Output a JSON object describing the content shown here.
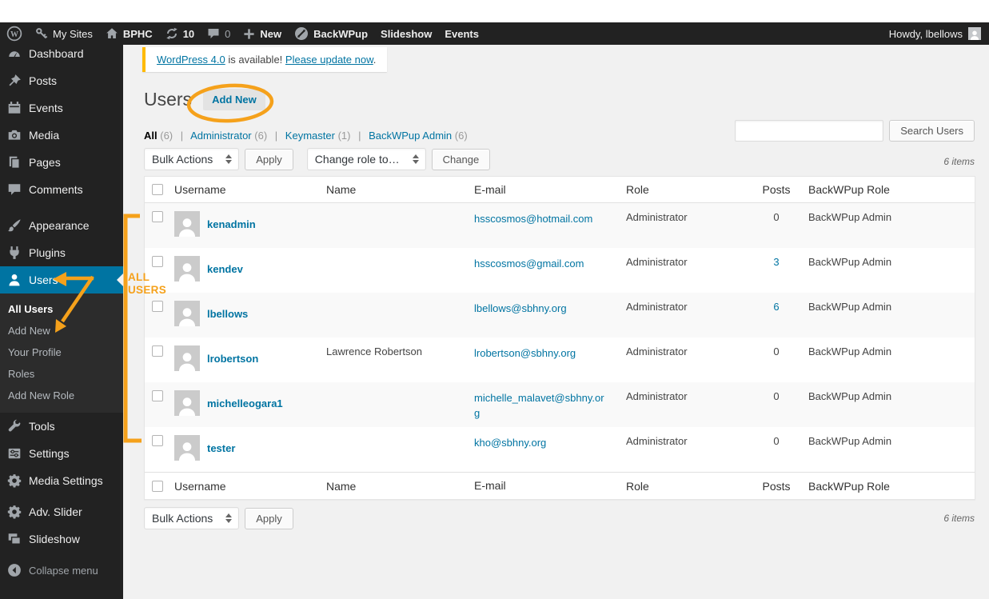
{
  "admin_bar": {
    "my_sites": "My Sites",
    "site_name": "BPHC",
    "update_count": "10",
    "comment_count": "0",
    "new_label": "New",
    "backwpup": "BackWPup",
    "slideshow": "Slideshow",
    "events": "Events",
    "howdy": "Howdy, lbellows"
  },
  "sidebar": {
    "items": [
      {
        "label": "Dashboard"
      },
      {
        "label": "Posts"
      },
      {
        "label": "Events"
      },
      {
        "label": "Media"
      },
      {
        "label": "Pages"
      },
      {
        "label": "Comments"
      },
      {
        "label": "Appearance"
      },
      {
        "label": "Plugins"
      },
      {
        "label": "Users"
      },
      {
        "label": "Tools"
      },
      {
        "label": "Settings"
      },
      {
        "label": "Media Settings"
      },
      {
        "label": "Adv. Slider"
      },
      {
        "label": "Slideshow"
      }
    ],
    "users_submenu": [
      {
        "label": "All Users"
      },
      {
        "label": "Add New"
      },
      {
        "label": "Your Profile"
      },
      {
        "label": "Roles"
      },
      {
        "label": "Add New Role"
      }
    ],
    "collapse": "Collapse menu"
  },
  "notice": {
    "link_version": "WordPress 4.0",
    "text_middle": " is available! ",
    "link_update": "Please update now",
    "text_end": "."
  },
  "page": {
    "title": "Users",
    "add_new": "Add New"
  },
  "filters": {
    "all_label": "All",
    "all_count": "(6)",
    "admin_label": "Administrator",
    "admin_count": "(6)",
    "keymaster_label": "Keymaster",
    "keymaster_count": "(1)",
    "backwpup_label": "BackWPup Admin",
    "backwpup_count": "(6)"
  },
  "toolbar": {
    "bulk_actions": "Bulk Actions",
    "apply": "Apply",
    "change_role": "Change role to…",
    "change": "Change",
    "search_button": "Search Users",
    "items_count": "6 items"
  },
  "table": {
    "columns": {
      "username": "Username",
      "name": "Name",
      "email": "E-mail",
      "role": "Role",
      "posts": "Posts",
      "backwpup_role": "BackWPup Role"
    },
    "rows": [
      {
        "username": "kenadmin",
        "name": "",
        "email": "hsscosmos@hotmail.com",
        "role": "Administrator",
        "posts": "0",
        "backwpup_role": "BackWPup Admin"
      },
      {
        "username": "kendev",
        "name": "",
        "email": "hsscosmos@gmail.com",
        "role": "Administrator",
        "posts": "3",
        "backwpup_role": "BackWPup Admin"
      },
      {
        "username": "lbellows",
        "name": "",
        "email": "lbellows@sbhny.org",
        "role": "Administrator",
        "posts": "6",
        "backwpup_role": "BackWPup Admin"
      },
      {
        "username": "lrobertson",
        "name": "Lawrence Robertson",
        "email": "lrobertson@sbhny.org",
        "role": "Administrator",
        "posts": "0",
        "backwpup_role": "BackWPup Admin"
      },
      {
        "username": "michelleogara1",
        "name": "",
        "email": "michelle_malavet@sbhny.org",
        "role": "Administrator",
        "posts": "0",
        "backwpup_role": "BackWPup Admin"
      },
      {
        "username": "tester",
        "name": "",
        "email": "kho@sbhny.org",
        "role": "Administrator",
        "posts": "0",
        "backwpup_role": "BackWPup Admin"
      }
    ]
  },
  "annotations": {
    "label_line1": "ALL",
    "label_line2": "USERS"
  },
  "colors": {
    "accent_blue": "#0074A2",
    "annotation_orange": "#F5A11B",
    "notice_border": "#FFBA00",
    "sidebar_bg": "#222222",
    "stripe": "#F9F9F9"
  },
  "icons": {
    "select_arrows": "up-down triangles",
    "wordpress_logo": "W in circle",
    "my_sites": "key",
    "site": "house",
    "updates": "circular arrows",
    "comments": "speech bubble",
    "new": "plus",
    "backwpup_logo": "circle with diagonal arrow",
    "avatar": "person silhouette"
  }
}
